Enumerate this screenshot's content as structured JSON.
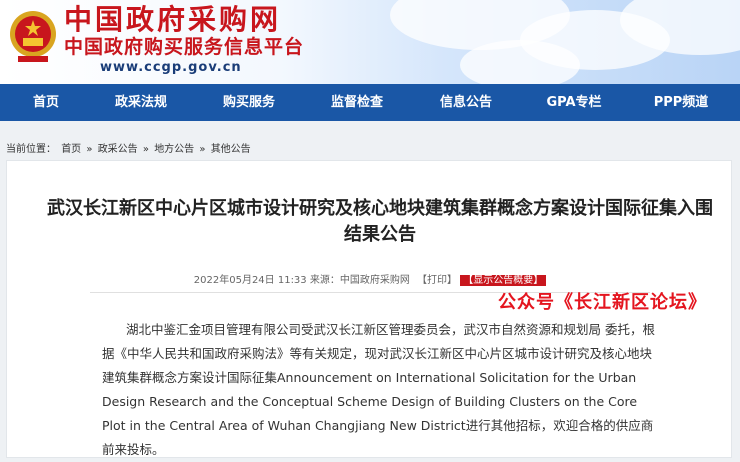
{
  "header": {
    "site_title": "中国政府采购网",
    "site_subtitle": "中国政府购买服务信息平台",
    "url": "www.ccgp.gov.cn"
  },
  "nav": {
    "items": [
      "首页",
      "政采法规",
      "购买服务",
      "监督检查",
      "信息公告",
      "GPA专栏",
      "PPP频道"
    ]
  },
  "breadcrumb": {
    "prefix": "当前位置：",
    "items": [
      "首页",
      "政采公告",
      "地方公告",
      "其他公告"
    ],
    "separator": "»"
  },
  "article": {
    "title": "武汉长江新区中心片区城市设计研究及核心地块建筑集群概念方案设计国际征集入围结果公告",
    "date": "2022年05月24日 11:33",
    "source_label": "来源：",
    "source": "中国政府采购网",
    "print_label": "【打印】",
    "summary_label": "【显示公告概要】",
    "body": "湖北中鉴汇金项目管理有限公司受武汉长江新区管理委员会，武汉市自然资源和规划局 委托，根据《中华人民共和国政府采购法》等有关规定，现对武汉长江新区中心片区城市设计研究及核心地块建筑集群概念方案设计国际征集Announcement on International Solicitation for the Urban Design Research and the Conceptual Scheme Design of Building Clusters on the Core Plot in the Central Area of Wuhan Changjiang New District进行其他招标，欢迎合格的供应商前来投标。"
  },
  "watermark": "公众号《长江新区论坛》",
  "colors": {
    "brand_red": "#c8161d",
    "nav_blue": "#1a57a6",
    "url_blue": "#1a3d78"
  }
}
